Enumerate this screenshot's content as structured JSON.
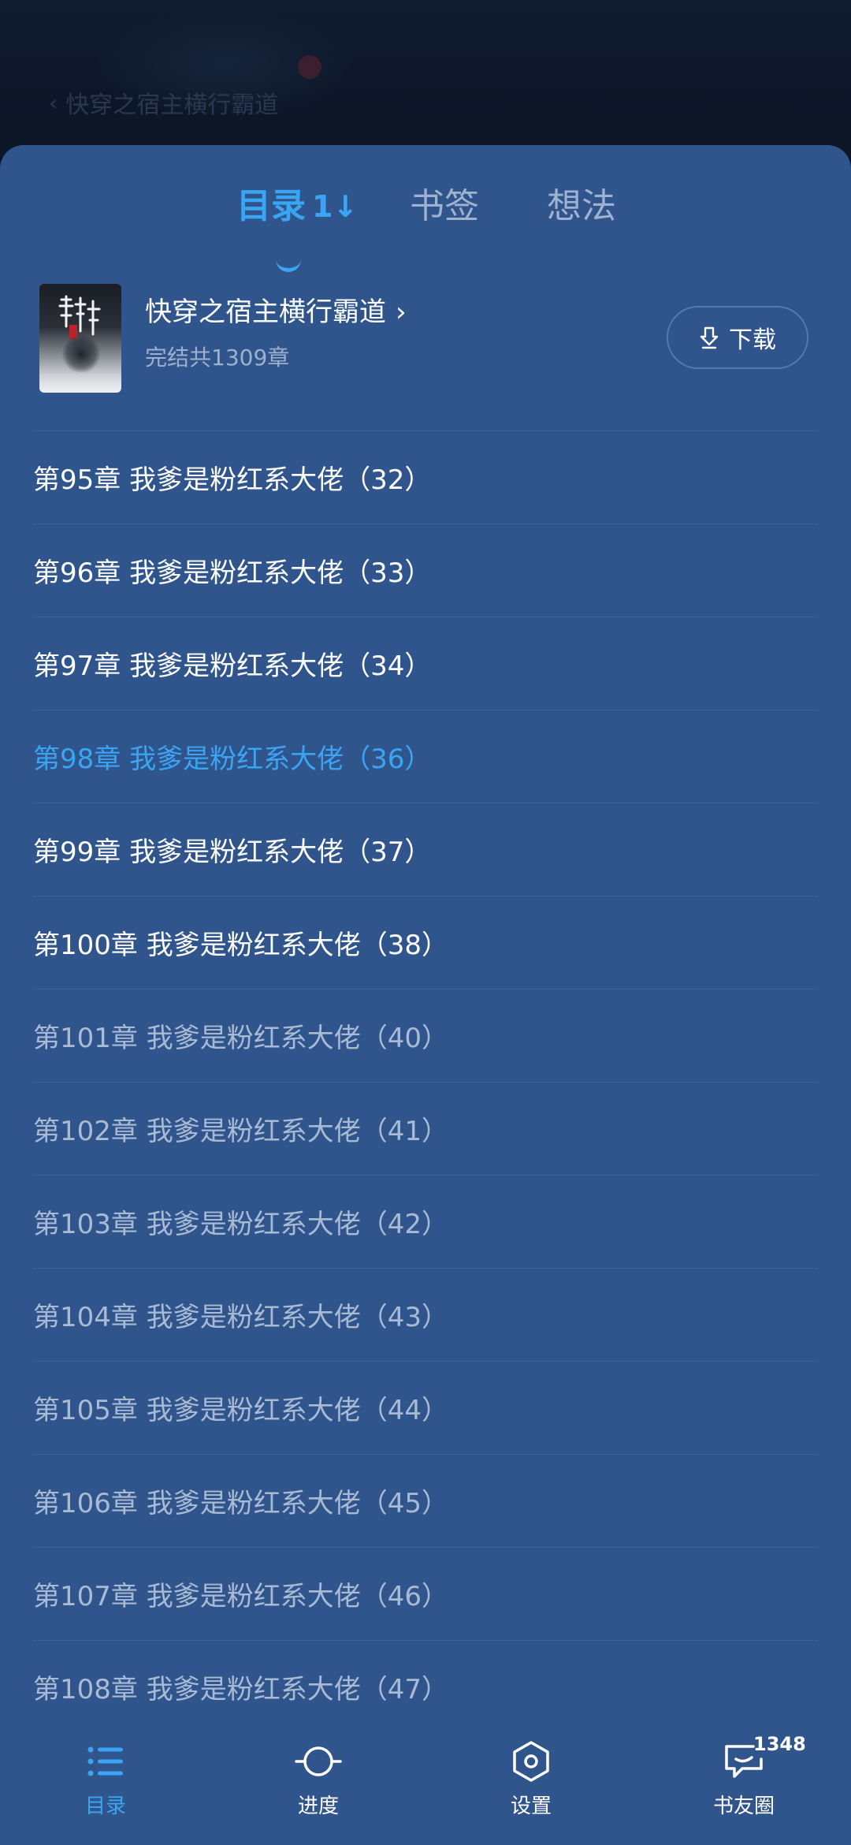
{
  "background": {
    "back_label": "快穿之宿主横行霸道"
  },
  "tabs": {
    "catalog": "目录",
    "sort_icon": "1↓",
    "bookmark": "书签",
    "ideas": "想法"
  },
  "book": {
    "cover_text": "宿主横行霸道",
    "title": "快穿之宿主横行霸道",
    "title_chevron": "›",
    "subtitle": "完结共1309章",
    "download_label": "下载"
  },
  "chapters": [
    {
      "text": "第95章 我爹是粉红系大佬（32）",
      "state": "read"
    },
    {
      "text": "第96章 我爹是粉红系大佬（33）",
      "state": "read"
    },
    {
      "text": "第97章 我爹是粉红系大佬（34）",
      "state": "read"
    },
    {
      "text": "第98章 我爹是粉红系大佬（36）",
      "state": "current"
    },
    {
      "text": "第99章 我爹是粉红系大佬（37）",
      "state": "read"
    },
    {
      "text": "第100章 我爹是粉红系大佬（38）",
      "state": "read"
    },
    {
      "text": "第101章 我爹是粉红系大佬（40）",
      "state": "unread"
    },
    {
      "text": "第102章 我爹是粉红系大佬（41）",
      "state": "unread"
    },
    {
      "text": "第103章 我爹是粉红系大佬（42）",
      "state": "unread"
    },
    {
      "text": "第104章 我爹是粉红系大佬（43）",
      "state": "unread"
    },
    {
      "text": "第105章 我爹是粉红系大佬（44）",
      "state": "unread"
    },
    {
      "text": "第106章 我爹是粉红系大佬（45）",
      "state": "unread"
    },
    {
      "text": "第107章 我爹是粉红系大佬（46）",
      "state": "unread"
    },
    {
      "text": "第108章 我爹是粉红系大佬（47）",
      "state": "unread"
    }
  ],
  "bottom_nav": {
    "catalog": "目录",
    "progress": "进度",
    "settings": "设置",
    "circle": "书友圈",
    "circle_badge": "1348"
  },
  "colors": {
    "sheet_bg": "#30558c",
    "accent": "#3aa6f3",
    "read_text": "#ffffff",
    "unread_text": "#a9bbd4",
    "divider": "#3e6298"
  },
  "icons": {
    "back": "chevron-left-icon",
    "sort": "sort-icon",
    "download": "download-icon",
    "catalog": "list-icon",
    "progress": "progress-circle-icon",
    "settings": "hexagon-settings-icon",
    "circle": "chat-bubble-icon"
  }
}
